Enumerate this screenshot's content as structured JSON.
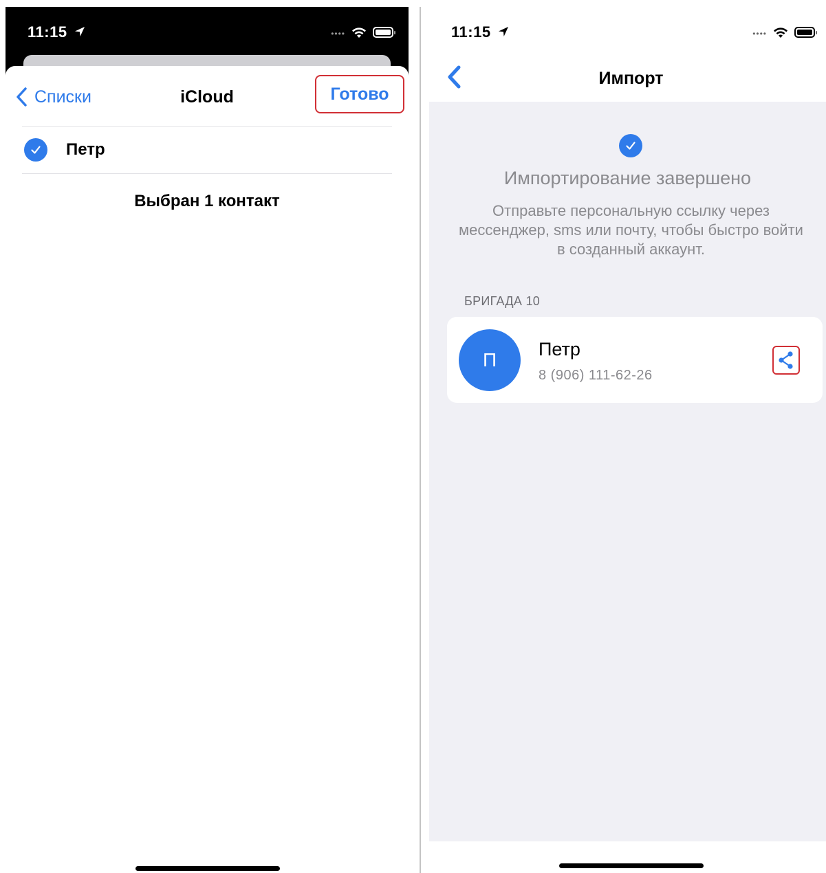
{
  "left": {
    "status": {
      "time": "11:15"
    },
    "nav": {
      "back_label": "Списки",
      "title": "iCloud",
      "done_label": "Готово"
    },
    "contact": {
      "name": "Петр",
      "selected": true
    },
    "selected_info": "Выбран 1 контакт"
  },
  "right": {
    "status": {
      "time": "11:15"
    },
    "nav": {
      "title": "Импорт"
    },
    "success": {
      "title": "Импортирование завершено",
      "description": "Отправьте персональную ссылку через мессенджер, sms или почту, чтобы быстро войти в созданный аккаунт."
    },
    "group_label": "БРИГАДА 10",
    "contact": {
      "initial": "П",
      "name": "Петр",
      "phone": "8 (906) 111-62-26"
    }
  },
  "colors": {
    "accent": "#2f7bea",
    "highlight": "#d12f35",
    "background": "#f0f0f5"
  },
  "icons": [
    "location-arrow-icon",
    "wifi-icon",
    "battery-icon",
    "chevron-left-icon",
    "checkmark-icon",
    "share-icon"
  ]
}
